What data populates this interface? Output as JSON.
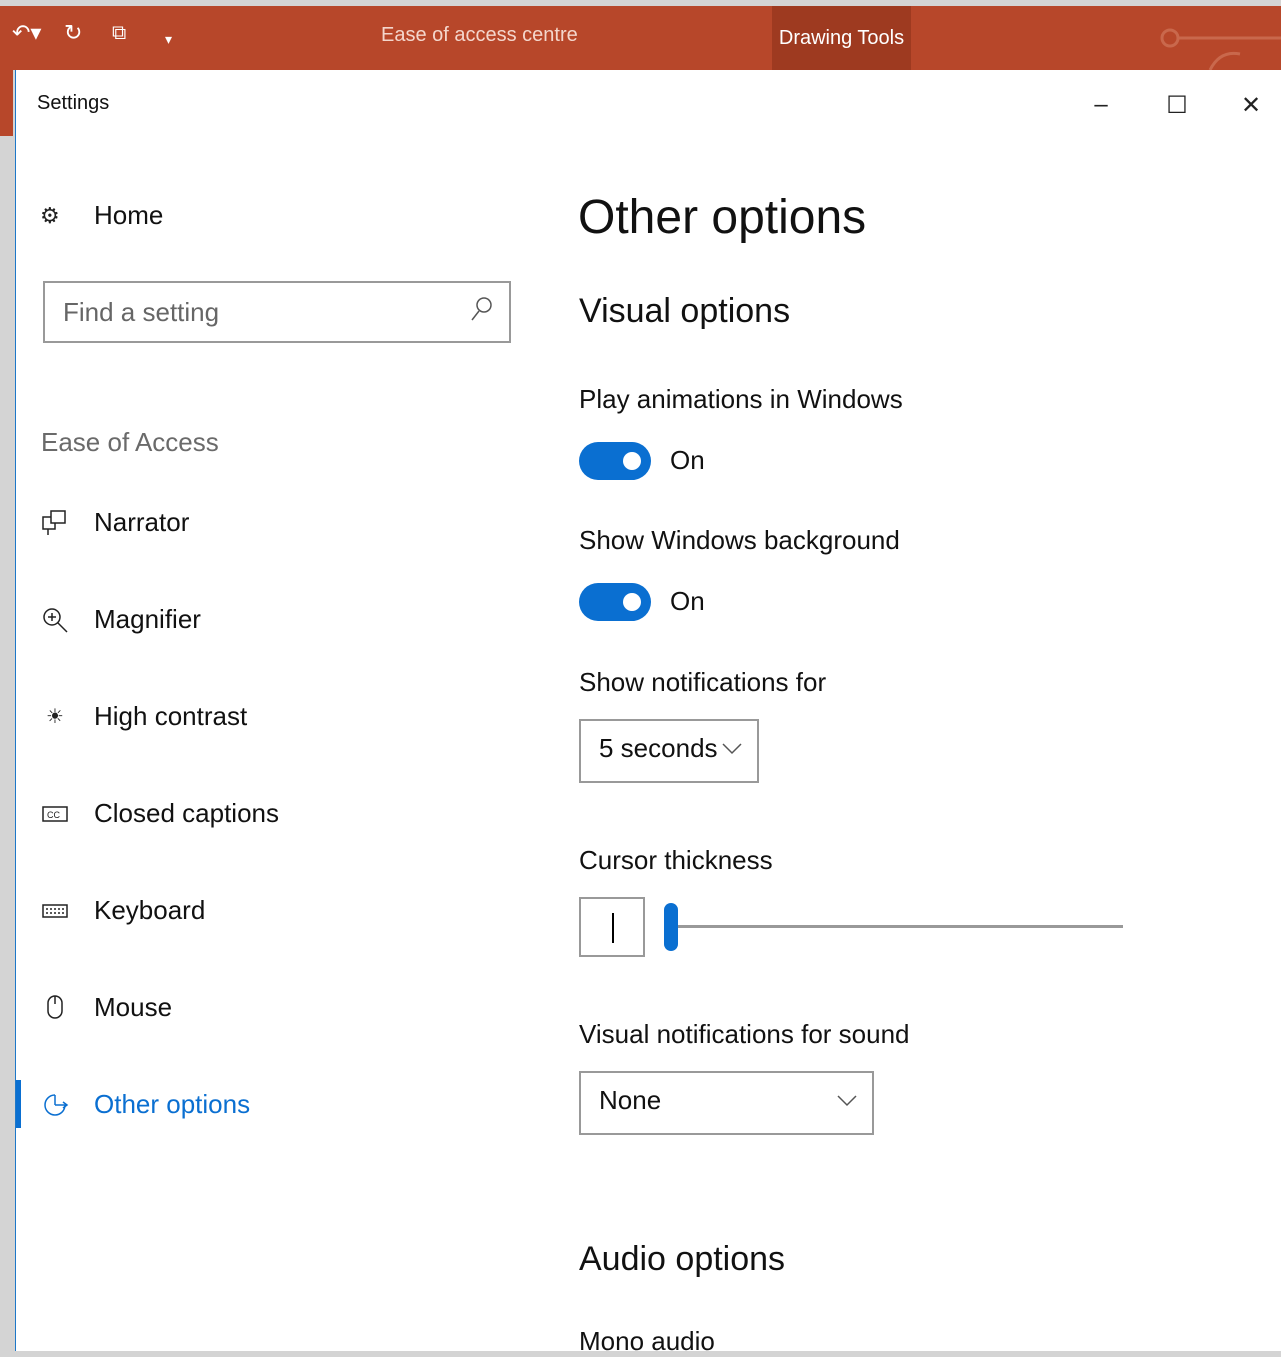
{
  "ppt": {
    "title": "Ease of access centre",
    "contextual_tab": "Drawing Tools",
    "quick_access": [
      "undo-icon",
      "redo-icon",
      "slideshow-icon",
      "customize-icon"
    ]
  },
  "window": {
    "title": "Settings",
    "minimize": "–",
    "maximize": "☐",
    "close": "✕"
  },
  "sidebar": {
    "home_label": "Home",
    "search_placeholder": "Find a setting",
    "section_label": "Ease of Access",
    "items": [
      {
        "label": "Narrator",
        "icon": "narrator-icon"
      },
      {
        "label": "Magnifier",
        "icon": "magnifier-icon"
      },
      {
        "label": "High contrast",
        "icon": "high-contrast-icon"
      },
      {
        "label": "Closed captions",
        "icon": "closed-captions-icon"
      },
      {
        "label": "Keyboard",
        "icon": "keyboard-icon"
      },
      {
        "label": "Mouse",
        "icon": "mouse-icon"
      },
      {
        "label": "Other options",
        "icon": "other-options-icon",
        "active": true
      }
    ]
  },
  "main": {
    "title": "Other options",
    "visual_heading": "Visual options",
    "animations": {
      "label": "Play animations in Windows",
      "state": "On"
    },
    "background": {
      "label": "Show Windows background",
      "state": "On"
    },
    "notifications": {
      "label": "Show notifications for",
      "value": "5 seconds"
    },
    "cursor": {
      "label": "Cursor thickness",
      "value_fraction": 0.0
    },
    "sound": {
      "label": "Visual notifications for sound",
      "value": "None"
    },
    "audio_heading": "Audio options",
    "mono_audio_label": "Mono audio"
  },
  "colors": {
    "accent": "#0a6fd1",
    "ribbon": "#b7472a"
  }
}
